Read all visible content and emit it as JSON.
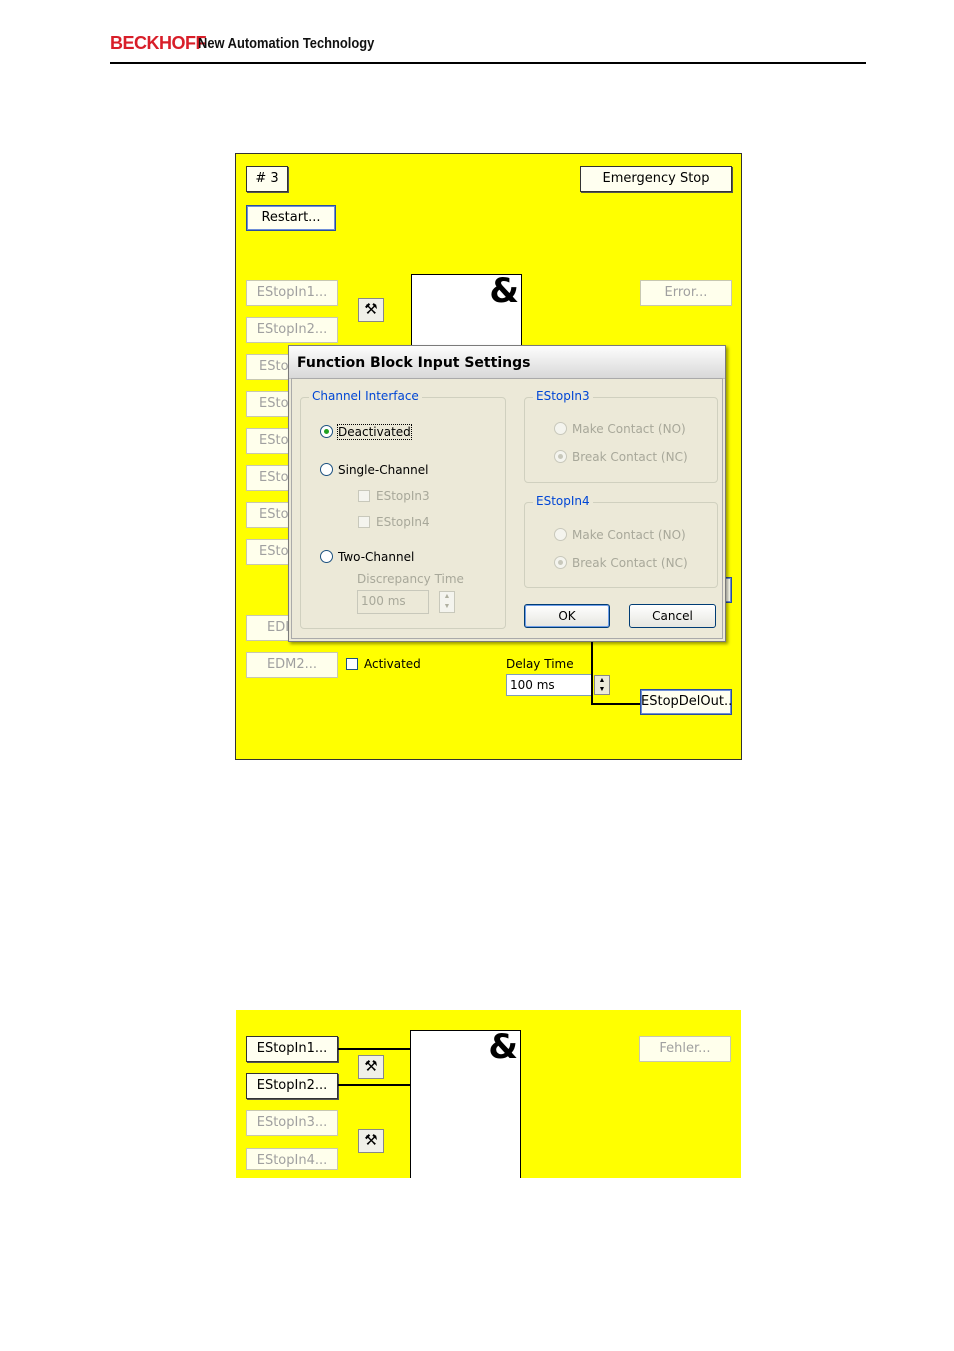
{
  "header": {
    "brand": "BECKHOFF",
    "tagline": "New Automation Technology"
  },
  "panel1": {
    "index_label": "# 3",
    "emergency_stop_label": "Emergency Stop",
    "restart_label": "Restart...",
    "error_label": "Error...",
    "inputs": [
      "EStopIn1...",
      "EStopIn2...",
      "ESto",
      "ESto",
      "ESto",
      "ESto",
      "ESto",
      "ESto"
    ],
    "edm1_label": "EDI",
    "edm2_label": "EDM2...",
    "activated_label": "Activated",
    "delay_time_label": "Delay Time",
    "delay_time_value": "100 ms",
    "estop_del_out_label": "EStopDelOut...",
    "and_symbol": "&",
    "tool_icon": "hammer-wrench-icon"
  },
  "dialog": {
    "title": "Function Block Input Settings",
    "channel_interface": {
      "label": "Channel Interface",
      "deactivated": "Deactivated",
      "single_channel": "Single-Channel",
      "single_estop3": "EStopIn3",
      "single_estop4": "EStopIn4",
      "two_channel": "Two-Channel",
      "discrepancy_time_label": "Discrepancy Time",
      "discrepancy_time_value": "100 ms",
      "selected": "Deactivated"
    },
    "estopin3": {
      "label": "EStopIn3",
      "make_contact": "Make Contact (NO)",
      "break_contact": "Break Contact (NC)",
      "selected": "Break Contact (NC)"
    },
    "estopin4": {
      "label": "EStopIn4",
      "make_contact": "Make Contact (NO)",
      "break_contact": "Break Contact (NC)",
      "selected": "Break Contact (NC)"
    },
    "ok_label": "OK",
    "cancel_label": "Cancel"
  },
  "panel2": {
    "error_label": "Fehler...",
    "inputs": [
      "EStopIn1...",
      "EStopIn2...",
      "EStopIn3...",
      "EStopIn4..."
    ],
    "and_symbol": "&"
  },
  "colors": {
    "panel_bg": "#ffff00",
    "brand_red": "#d81e29",
    "dialog_bg": "#ece9d8",
    "group_label_blue": "#0046d5"
  }
}
